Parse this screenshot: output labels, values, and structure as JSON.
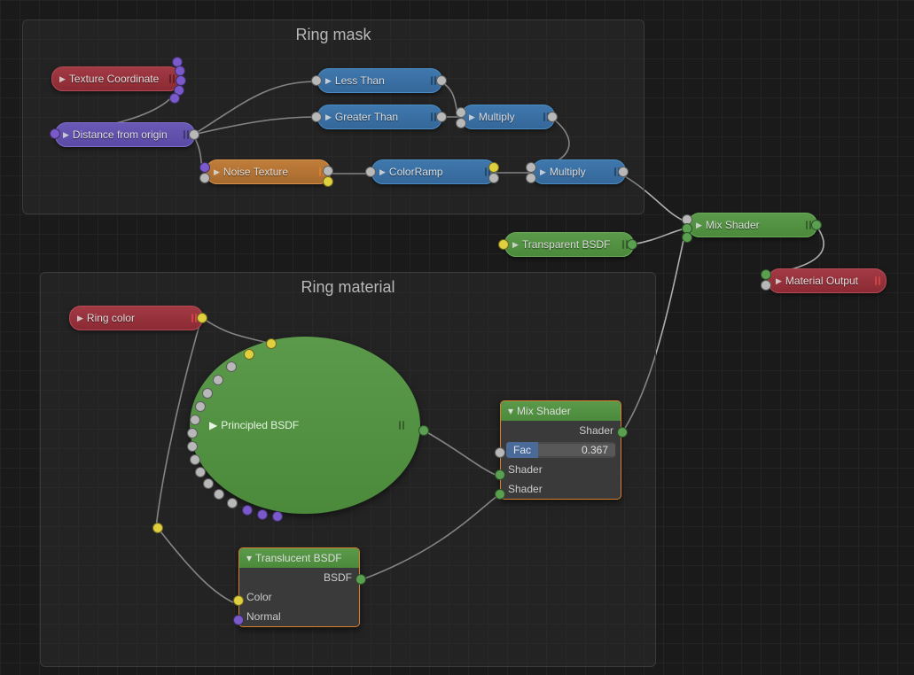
{
  "frames": {
    "mask": {
      "title": "Ring mask"
    },
    "material": {
      "title": "Ring material"
    }
  },
  "nodes": {
    "texcoord": {
      "label": "Texture Coordinate"
    },
    "distance": {
      "label": "Distance from origin"
    },
    "noise": {
      "label": "Noise Texture"
    },
    "lessthan": {
      "label": "Less Than"
    },
    "greaterthan": {
      "label": "Greater Than"
    },
    "multiply1": {
      "label": "Multiply"
    },
    "colorramp": {
      "label": "ColorRamp"
    },
    "multiply2": {
      "label": "Multiply"
    },
    "transparent": {
      "label": "Transparent BSDF"
    },
    "mixshader_outer": {
      "label": "Mix Shader"
    },
    "matoutput": {
      "label": "Material Output"
    },
    "ringcolor": {
      "label": "Ring color"
    },
    "principled": {
      "label": "Principled BSDF"
    },
    "translucent": {
      "header": "Translucent BSDF",
      "out": "BSDF",
      "in_color": "Color",
      "in_normal": "Normal"
    },
    "mixshader_inner": {
      "header": "Mix Shader",
      "out": "Shader",
      "fac_label": "Fac",
      "fac_value": "0.367",
      "in_shader1": "Shader",
      "in_shader2": "Shader"
    }
  }
}
